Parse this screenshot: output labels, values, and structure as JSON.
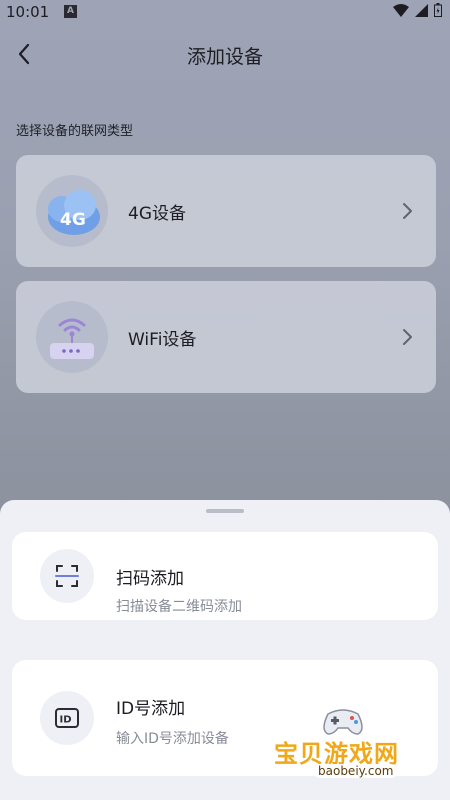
{
  "status_bar": {
    "time": "10:01",
    "notification_letter": "A"
  },
  "header": {
    "title": "添加设备"
  },
  "section_label": "选择设备的联网类型",
  "device_types": [
    {
      "label": "4G设备",
      "icon": "4g-cloud-icon",
      "badge_text": "4G"
    },
    {
      "label": "WiFi设备",
      "icon": "wifi-router-icon"
    }
  ],
  "sheet": {
    "options": [
      {
        "title": "扫码添加",
        "subtitle": "扫描设备二维码添加",
        "icon": "scan-icon"
      },
      {
        "title": "ID号添加",
        "subtitle": "输入ID号添加设备",
        "icon": "id-card-icon",
        "icon_text": "ID"
      }
    ]
  },
  "watermark": {
    "text": "宝贝游戏网",
    "url": "baobeiy.com"
  }
}
